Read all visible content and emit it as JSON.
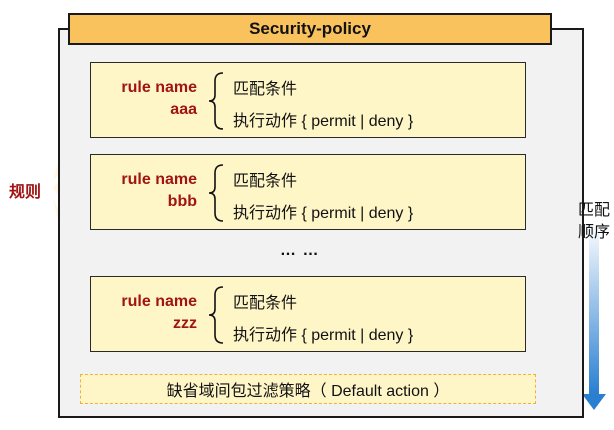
{
  "policy": {
    "title": "Security-policy"
  },
  "rules_label": "规则",
  "rules": [
    {
      "name_label": "rule name",
      "id": "aaa",
      "condition": "匹配条件",
      "action": "执行动作 { permit | deny }"
    },
    {
      "name_label": "rule name",
      "id": "bbb",
      "condition": "匹配条件",
      "action": "执行动作 { permit | deny }"
    },
    {
      "name_label": "rule name",
      "id": "zzz",
      "condition": "匹配条件",
      "action": "执行动作 { permit | deny }"
    }
  ],
  "ellipsis": "… …",
  "default_action": "缺省域间包过滤策略（ Default action ）",
  "match_order": {
    "line1": "匹配",
    "line2": "顺序"
  },
  "colors": {
    "title_fill": "#f9c25c",
    "rule_fill": "#fff6c8",
    "label_red": "#a01414",
    "arrow_blue": "#2a7fd0"
  }
}
